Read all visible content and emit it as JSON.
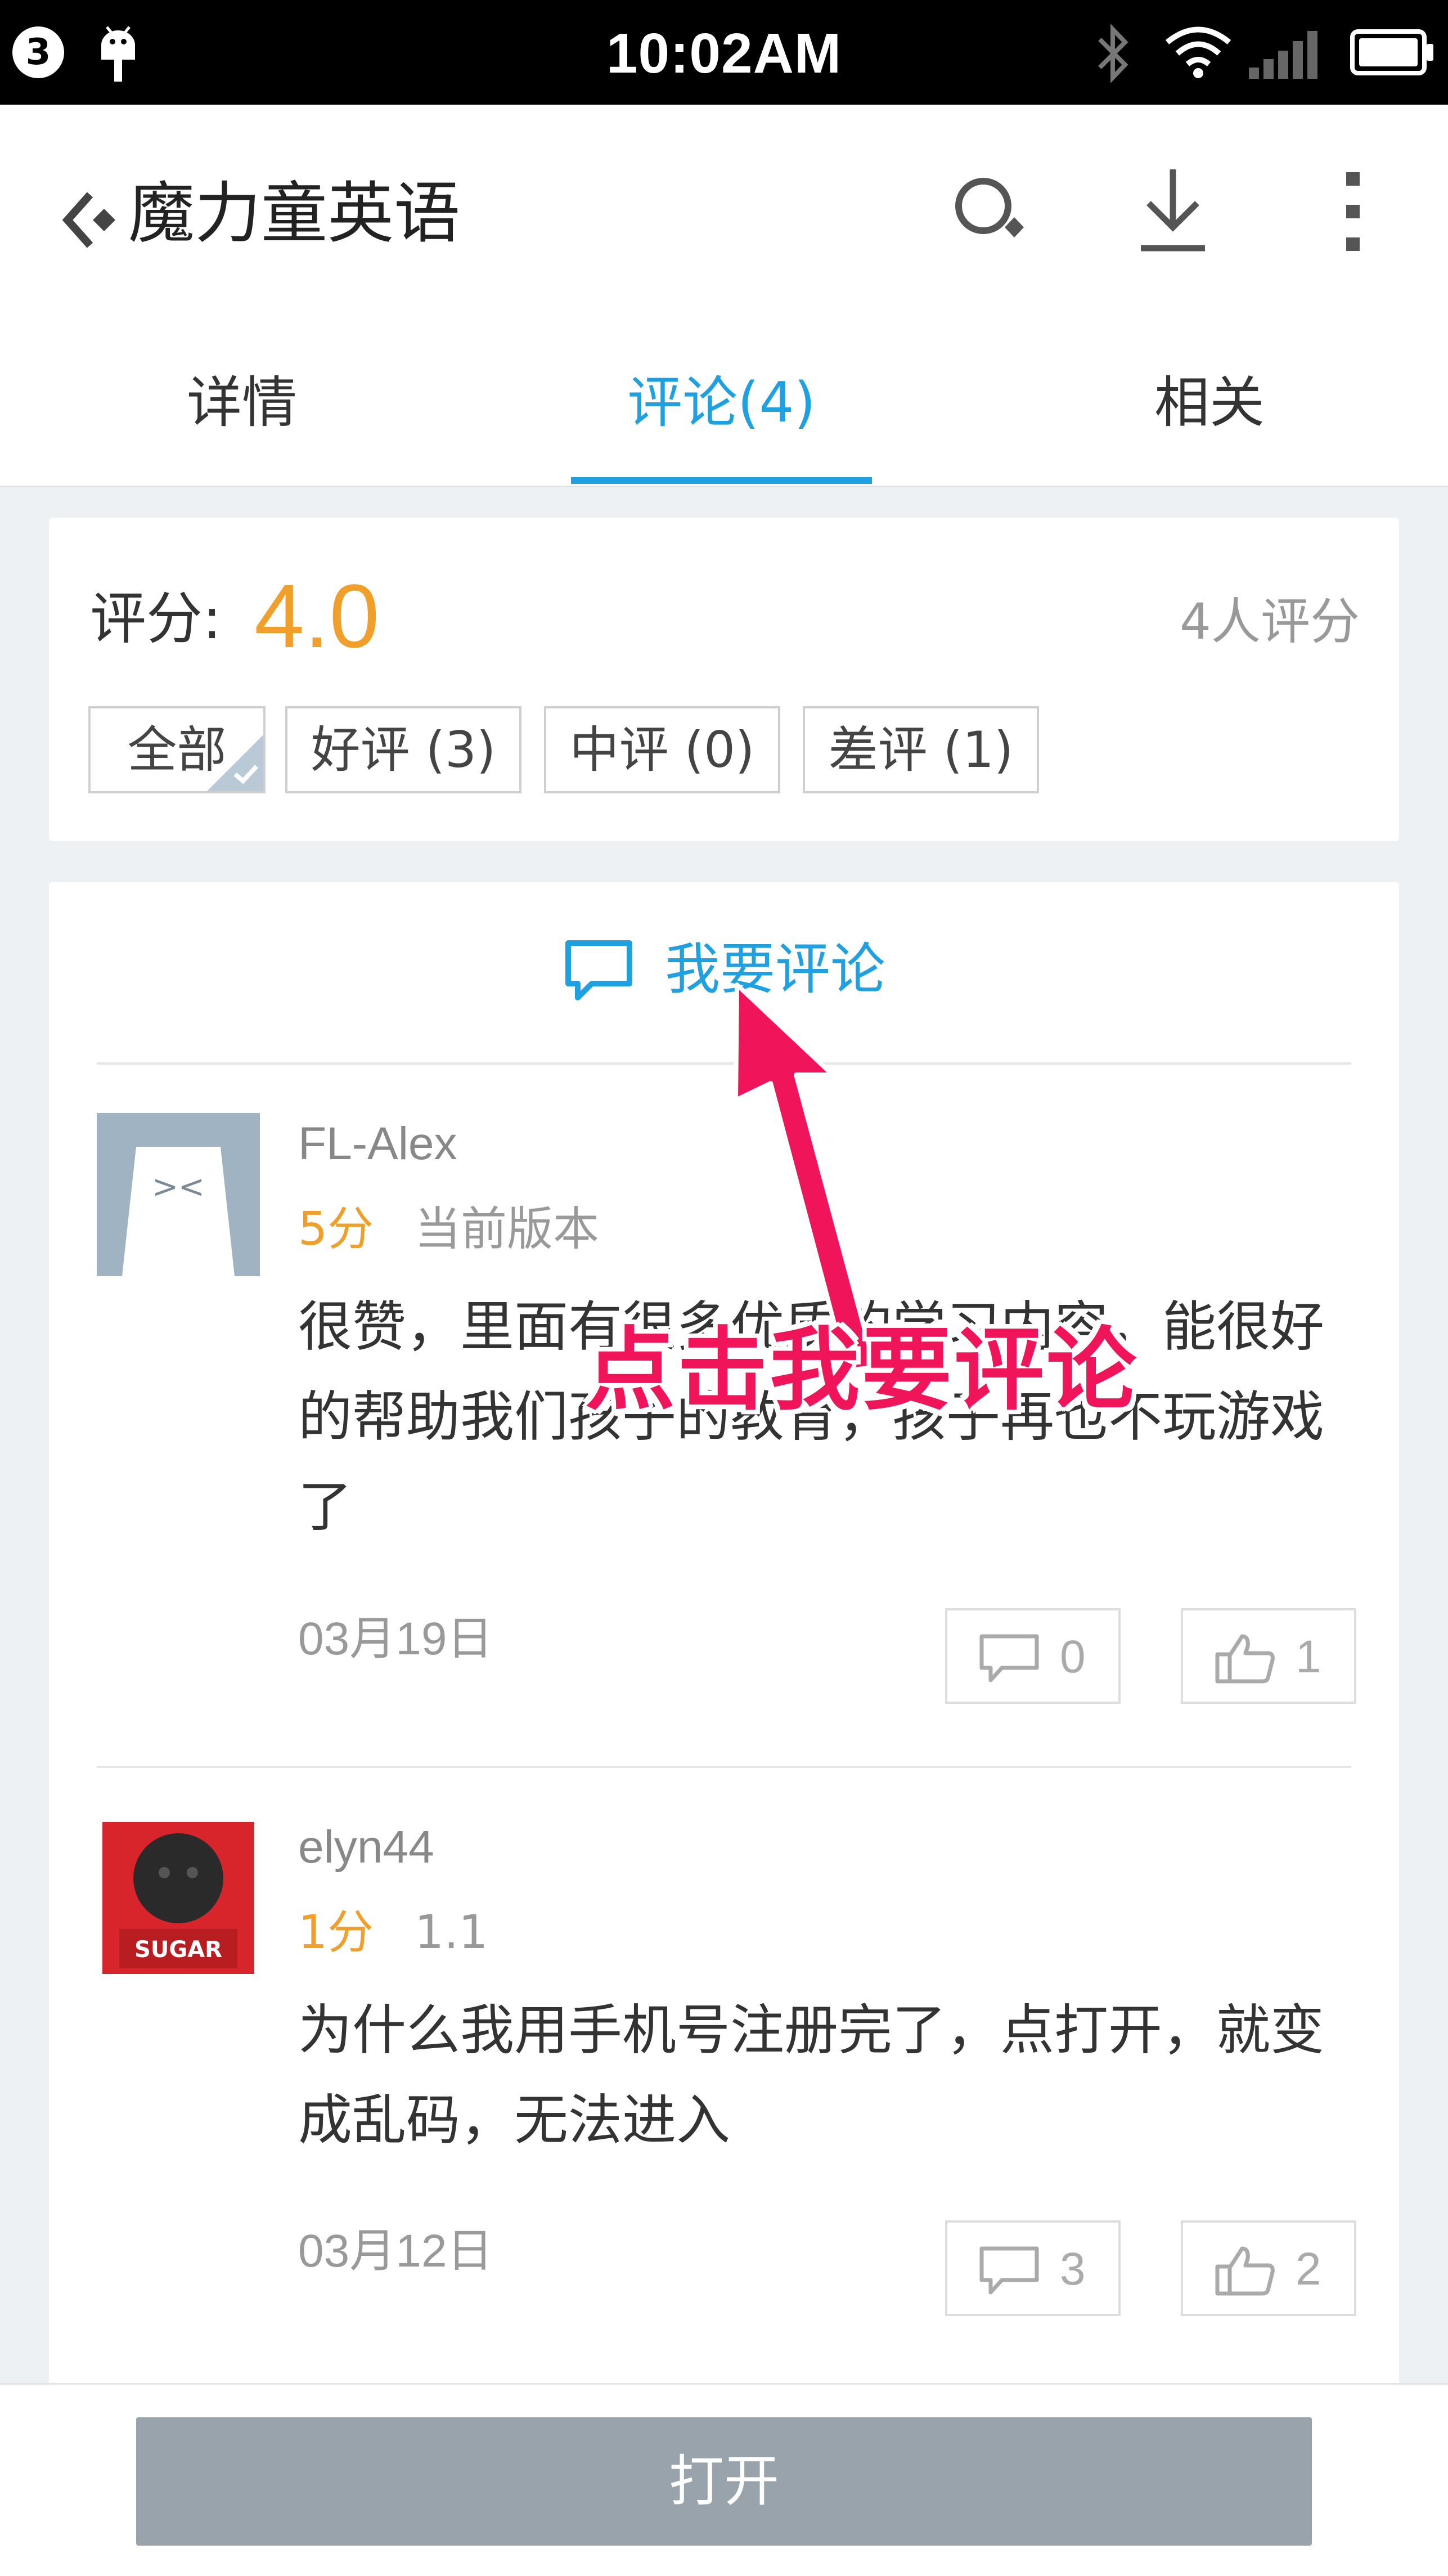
{
  "status_bar": {
    "notification_count": "3",
    "time": "10:02AM"
  },
  "header": {
    "title": "魔力童英语",
    "icons": [
      "back-icon",
      "search-icon",
      "download-icon",
      "more-icon"
    ]
  },
  "tabs": [
    {
      "label": "详情",
      "active": false
    },
    {
      "label": "评论(4)",
      "active": true
    },
    {
      "label": "相关",
      "active": false
    }
  ],
  "rating": {
    "label": "评分:",
    "value": "4.0",
    "count_text": "4人评分",
    "filters": [
      {
        "label": "全部",
        "selected": true
      },
      {
        "label": "好评 (3)",
        "selected": false
      },
      {
        "label": "中评 (0)",
        "selected": false
      },
      {
        "label": "差评 (1)",
        "selected": false
      }
    ]
  },
  "write_comment": {
    "label": "我要评论"
  },
  "comments": [
    {
      "user": "FL-Alex",
      "score": "5分",
      "version": "当前版本",
      "text": "很赞，里面有很多优质的学习内容，能很好的帮助我们孩子的教育，孩子再也不玩游戏了",
      "date": "03月19日",
      "reply_count": "0",
      "like_count": "1"
    },
    {
      "user": "elyn44",
      "score": "1分",
      "version": "1.1",
      "text": "为什么我用手机号注册完了，点打开，就变成乱码，无法进入",
      "date": "03月12日",
      "reply_count": "3",
      "like_count": "2"
    }
  ],
  "bottom": {
    "open_label": "打开"
  },
  "annotation": {
    "text": "点击我要评论"
  },
  "colors": {
    "accent_blue": "#1ea0e1",
    "rating_orange": "#f0a02a",
    "annotation_pink": "#f0145a",
    "open_button_gray": "#98a3ab"
  }
}
